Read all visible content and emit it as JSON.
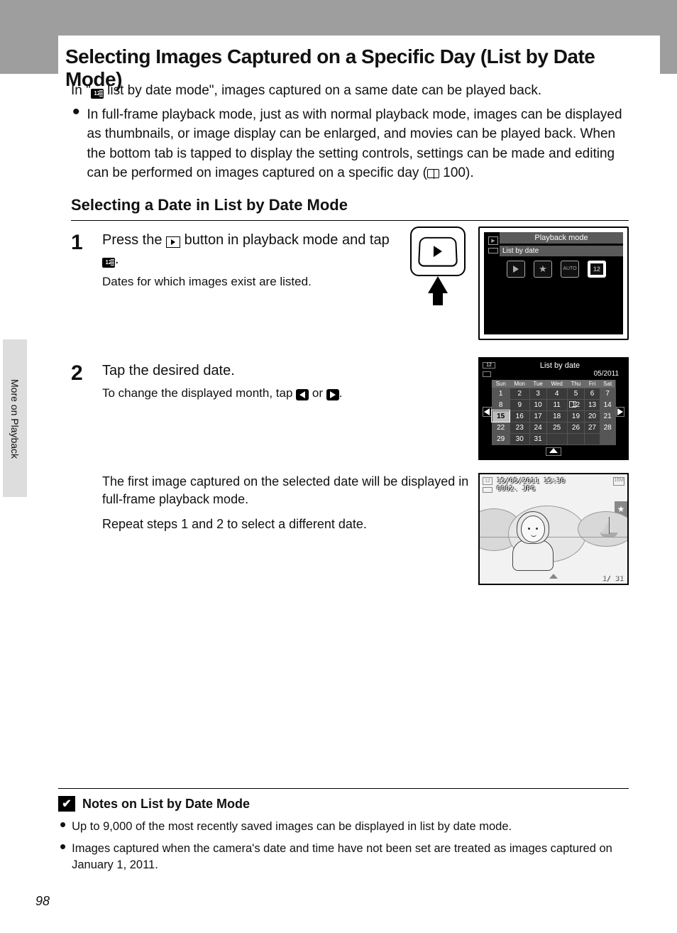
{
  "title": "Selecting Images Captured on a Specific Day (List by Date Mode)",
  "intro1a": "In \"",
  "intro1b": " list by date mode\", images captured on a same date can be played back.",
  "bullet1": "In full-frame playback mode, just as with normal playback mode, images can be displayed as thumbnails, or image display can be enlarged, and movies can be played back. When the bottom tab is tapped to display the setting controls, settings can be made and editing can be performed on images captured on a specific day (",
  "bullet1_ref": " 100).",
  "subheading": "Selecting a Date in List by Date Mode",
  "step1_head_a": "Press the ",
  "step1_head_b": " button in playback mode and tap ",
  "step1_head_c": ".",
  "step1_sub": "Dates for which images exist are listed.",
  "screen1_title": "Playback mode",
  "screen1_sub": "List by date",
  "mode_auto": "AUTO",
  "mode_cal_label": "12",
  "step2_head": "Tap the desired date.",
  "step2_sub_a": "To change the displayed month, tap ",
  "step2_sub_b": " or ",
  "step2_sub_c": ".",
  "cal_title": "List by date",
  "cal_month": "05/2011",
  "cal_days": [
    "Sun",
    "Mon",
    "Tue",
    "Wed",
    "Thu",
    "Fri",
    "Sat"
  ],
  "cal_rows": [
    [
      "1",
      "2",
      "3",
      "4",
      "5",
      "6",
      "7"
    ],
    [
      "8",
      "9",
      "10",
      "11",
      "12",
      "13",
      "14"
    ],
    [
      "15",
      "16",
      "17",
      "18",
      "19",
      "20",
      "21"
    ],
    [
      "22",
      "23",
      "24",
      "25",
      "26",
      "27",
      "28"
    ],
    [
      "29",
      "30",
      "31",
      "",
      "",
      "",
      ""
    ]
  ],
  "para_after_a": "The first image captured on the selected date will be displayed in full-frame playback mode.",
  "para_after_b": "Repeat steps 1 and 2 to select a different date.",
  "prev_datetime": "15/05/2011 15:30",
  "prev_file": "0002. JPG",
  "prev_count": "1/   31",
  "side_tab": "More on Playback",
  "notes_title": "Notes on List by Date Mode",
  "notes_b1": "Up to 9,000 of the most recently saved images can be displayed in list by date mode.",
  "notes_b2": "Images captured when the camera's date and time have not been set are treated as images captured on January 1, 2011.",
  "page_num": "98",
  "icon_cal_text": "12"
}
